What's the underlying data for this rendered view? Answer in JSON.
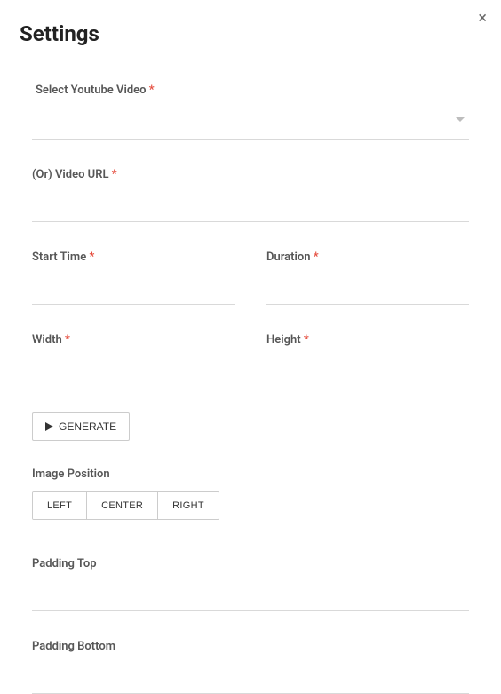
{
  "close_label": "×",
  "title": "Settings",
  "fields": {
    "select_video": {
      "label": "Select Youtube Video",
      "required_mark": "*"
    },
    "video_url": {
      "label": "(Or) Video URL",
      "required_mark": "*"
    },
    "start_time": {
      "label": "Start Time",
      "required_mark": "*"
    },
    "duration": {
      "label": "Duration",
      "required_mark": "*"
    },
    "width": {
      "label": "Width",
      "required_mark": "*"
    },
    "height": {
      "label": "Height",
      "required_mark": "*"
    },
    "padding_top": {
      "label": "Padding Top"
    },
    "padding_bottom": {
      "label": "Padding Bottom"
    }
  },
  "generate_button": "GENERATE",
  "image_position": {
    "heading": "Image Position",
    "options": {
      "left": "LEFT",
      "center": "CENTER",
      "right": "RIGHT"
    }
  }
}
